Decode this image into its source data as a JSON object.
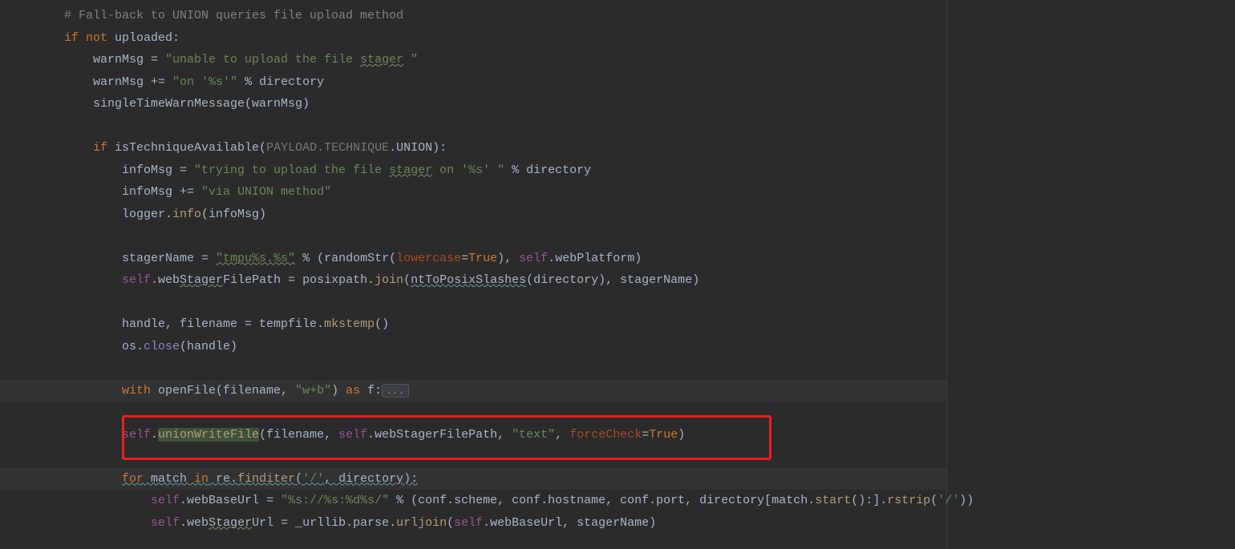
{
  "code": {
    "l1_comment": "# Fall-back to UNION queries file upload method",
    "l2_if": "if",
    "l2_not": "not",
    "l2_uploaded": " uploaded:",
    "l3_a": "warnMsg = ",
    "l3_s": "\"unable to upload the file ",
    "l3_s2": "stager",
    "l3_s3": " \"",
    "l4_a": "warnMsg += ",
    "l4_s": "\"on '%s'\"",
    "l4_b": " % directory",
    "l5": "singleTimeWarnMessage(warnMsg)",
    "l7_if": "if",
    "l7_a": " isTechniqueAvailable(",
    "l7_b": "PAYLOAD.TECHNIQUE",
    "l7_c": ".UNION):",
    "l8_a": "infoMsg = ",
    "l8_s1": "\"trying to upload the file ",
    "l8_s2": "stager",
    "l8_s3": " on '%s' \"",
    "l8_b": " % directory",
    "l9_a": "infoMsg += ",
    "l9_s": "\"via UNION method\"",
    "l10_a": "logger.",
    "l10_b": "info",
    "l10_c": "(infoMsg)",
    "l12_a": "stagerName = ",
    "l12_s": "\"tmpu%s.%s\"",
    "l12_b": " % (randomStr(",
    "l12_p": "lowercase",
    "l12_c": "=",
    "l12_t": "True",
    "l12_d": "), ",
    "l12_self": "self",
    "l12_e": ".webPlatform)",
    "l13_self": "self",
    "l13_a": ".web",
    "l13_a2": "Stager",
    "l13_a3": "FilePath = posixpath.",
    "l13_b": "join",
    "l13_c": "(",
    "l13_d": "ntToPosixSlashes",
    "l13_e": "(directory), stagerName)",
    "l15_a": "handle, filename = tempfile.",
    "l15_b": "mkstemp",
    "l15_c": "()",
    "l16_a": "os.",
    "l16_b": "close",
    "l16_c": "(handle)",
    "l18_w": "with",
    "l18_a": " openFile(filename, ",
    "l18_s": "\"w+b\"",
    "l18_b": ") ",
    "l18_as": "as",
    "l18_c": " f:",
    "fold": "...",
    "l20_self": "self",
    "l20_a": ".",
    "l20_m": "unionWriteFile",
    "l20_b": "(filename, ",
    "l20_self2": "self",
    "l20_c": ".webStagerFilePath, ",
    "l20_s": "\"text\"",
    "l20_d": ", ",
    "l20_p": "forceCheck",
    "l20_e": "=",
    "l20_t": "True",
    "l20_f": ")",
    "l22_for": "for",
    "l22_a": " match ",
    "l22_in": "in",
    "l22_b": " re.",
    "l22_c": "finditer",
    "l22_d": "(",
    "l22_s": "'/'",
    "l22_e": ", directory):",
    "l23_self": "self",
    "l23_a": ".webBaseUrl = ",
    "l23_s": "\"%s://%s:%d%s/\"",
    "l23_b": " % (conf.scheme, conf.hostname, conf.port, directory[match.",
    "l23_c": "start",
    "l23_d": "():].",
    "l23_e": "rstrip",
    "l23_f": "(",
    "l23_s2": "'/'",
    "l23_g": "))",
    "l24_self": "self",
    "l24_a": ".web",
    "l24_a2": "Stager",
    "l24_a3": "Url = _urllib.parse.",
    "l24_b": "urljoin",
    "l24_c": "(",
    "l24_self2": "self",
    "l24_d": ".webBaseUrl, stagerName)"
  }
}
